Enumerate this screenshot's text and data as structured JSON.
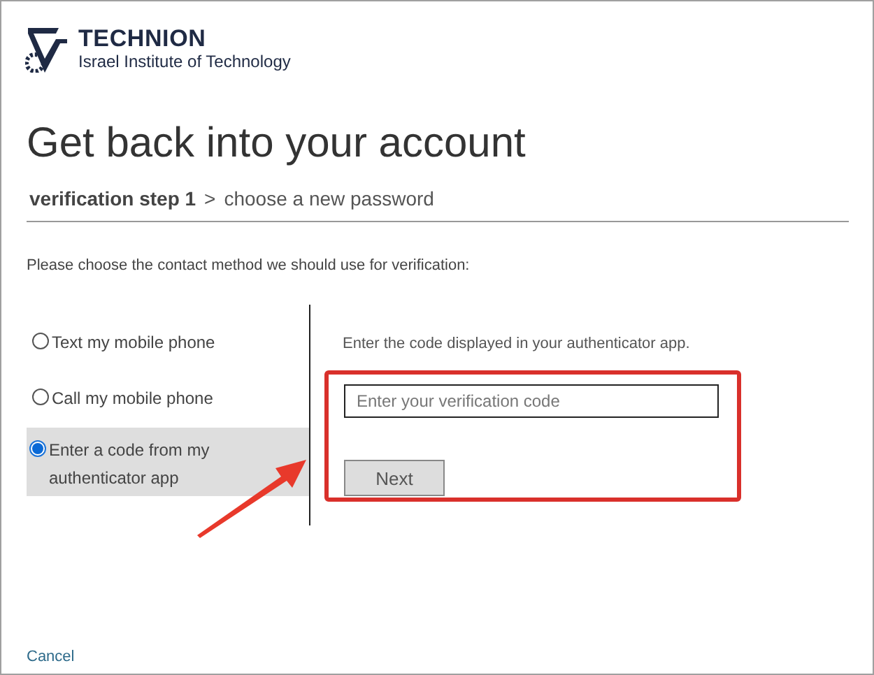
{
  "logo": {
    "name": "TECHNION",
    "subtitle": "Israel Institute of Technology"
  },
  "title": "Get back into your account",
  "steps": [
    {
      "label": "verification step 1",
      "selected": true
    },
    {
      "label": "choose a new password",
      "selected": false
    }
  ],
  "step_separator": ">",
  "instruction": "Please choose the contact method we should use for verification:",
  "methods": [
    {
      "label": "Text my mobile phone",
      "selected": false
    },
    {
      "label": "Call my mobile phone",
      "selected": false
    },
    {
      "label": "Enter a code from my authenticator app",
      "selected": true
    }
  ],
  "detail": {
    "instruction": "Enter the code displayed in your authenticator app.",
    "placeholder": "Enter your verification code",
    "button": "Next",
    "button_disabled": true
  },
  "cancel": "Cancel"
}
